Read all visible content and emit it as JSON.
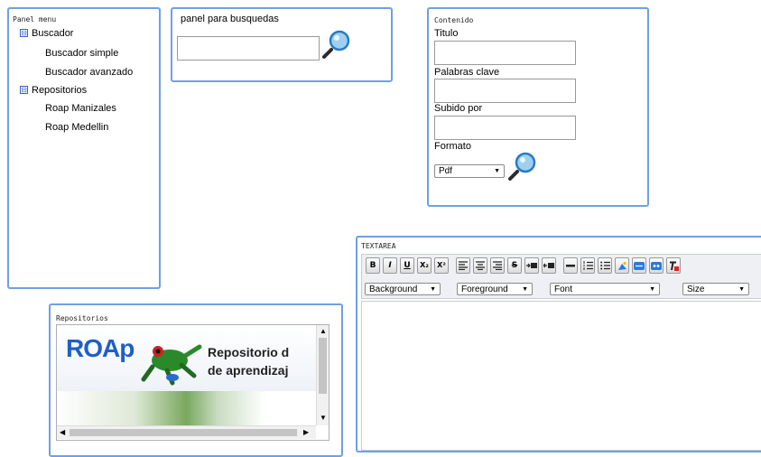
{
  "panel_menu": {
    "title": "Panel menu",
    "buscador_label": "Buscador",
    "buscador_simple": "Buscador simple",
    "buscador_avanzado": "Buscador avanzado",
    "repositorios_label": "Repositorios",
    "roap_manizales": "Roap Manizales",
    "roap_medellin": "Roap Medellin",
    "toggle_symbol": "⊟"
  },
  "search_panel": {
    "title": "panel para busquedas",
    "input_value": ""
  },
  "contenido": {
    "title": "Contenido",
    "titulo_label": "Titulo",
    "palabras_label": "Palabras clave",
    "subido_label": "Subido por",
    "formato_label": "Formato",
    "formato_value": "Pdf"
  },
  "textarea": {
    "title": "TEXTAREA",
    "toolbar": {
      "bold": "B",
      "italic": "I",
      "underline": "U",
      "subscript": "X₂",
      "superscript": "X²",
      "strike": "S"
    },
    "background_label": "Background",
    "foreground_label": "Foreground",
    "font_label": "Font",
    "size_label": "Size",
    "dropdown_arrow": "▼"
  },
  "repositorios": {
    "title": "Repositorios",
    "banner_logo": "ROAp",
    "banner_line1": "Repositorio d",
    "banner_line2": "de aprendizaj"
  },
  "colors": {
    "panel_border": "#6f9fe6",
    "logo_blue": "#1f5fc6"
  }
}
